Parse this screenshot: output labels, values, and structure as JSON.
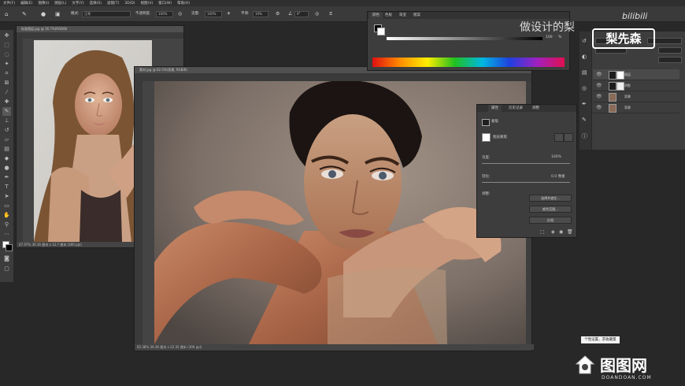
{
  "menu": [
    "文件(F)",
    "编辑(E)",
    "图像(I)",
    "图层(L)",
    "文字(Y)",
    "选择(S)",
    "滤镜(T)",
    "3D(D)",
    "视图(V)",
    "窗口(W)",
    "帮助(H)"
  ],
  "options": {
    "mode_label": "模式:",
    "mode_value": "正常",
    "opacity_label": "不透明度:",
    "opacity_value": "100%",
    "flow_label": "流量:",
    "flow_value": "100%",
    "smooth_label": "平滑:",
    "smooth_value": "10%",
    "angle_value": "0°"
  },
  "doc1": {
    "tab": "标准图层.jpg @ 16.7%(RGB/8)",
    "status": "47.97%   36.36 厘米 x 12.7 厘米 (300 ppi)"
  },
  "doc2": {
    "tab": "素材.jpg @ 62.5%(背景, RGB/8)",
    "status": "62.38%   36.36 厘米 x 22.35 厘米 (300 ppi)"
  },
  "color_panel": {
    "tabs": [
      "颜色",
      "色板",
      "渐变",
      "图案"
    ],
    "k_value": "100",
    "k_unit": "%"
  },
  "properties": {
    "tabs": [
      "属性",
      "历史记录",
      "调整"
    ],
    "type_label": "蒙版",
    "pixel_label": "图层蒙版",
    "density_label": "浓度:",
    "density_value": "100%",
    "feather_label": "羽化:",
    "feather_value": "0.0 像素",
    "refine_label": "调整:",
    "btn_select_mask": "选择并遮住...",
    "btn_color_range": "颜色范围...",
    "btn_invert": "反相"
  },
  "layers": {
    "items": [
      {
        "name": "图层"
      },
      {
        "name": "阴影"
      },
      {
        "name": "背景"
      },
      {
        "name": "背景"
      }
    ]
  },
  "watermarks": {
    "top_text": "做设计的梨",
    "logo_text": "梨先森",
    "bili": "bilibili",
    "bottom_text": "DOANDOAN.COM",
    "bottom_brand": "图图网"
  },
  "tooltip": "个性设置，求收藏量"
}
